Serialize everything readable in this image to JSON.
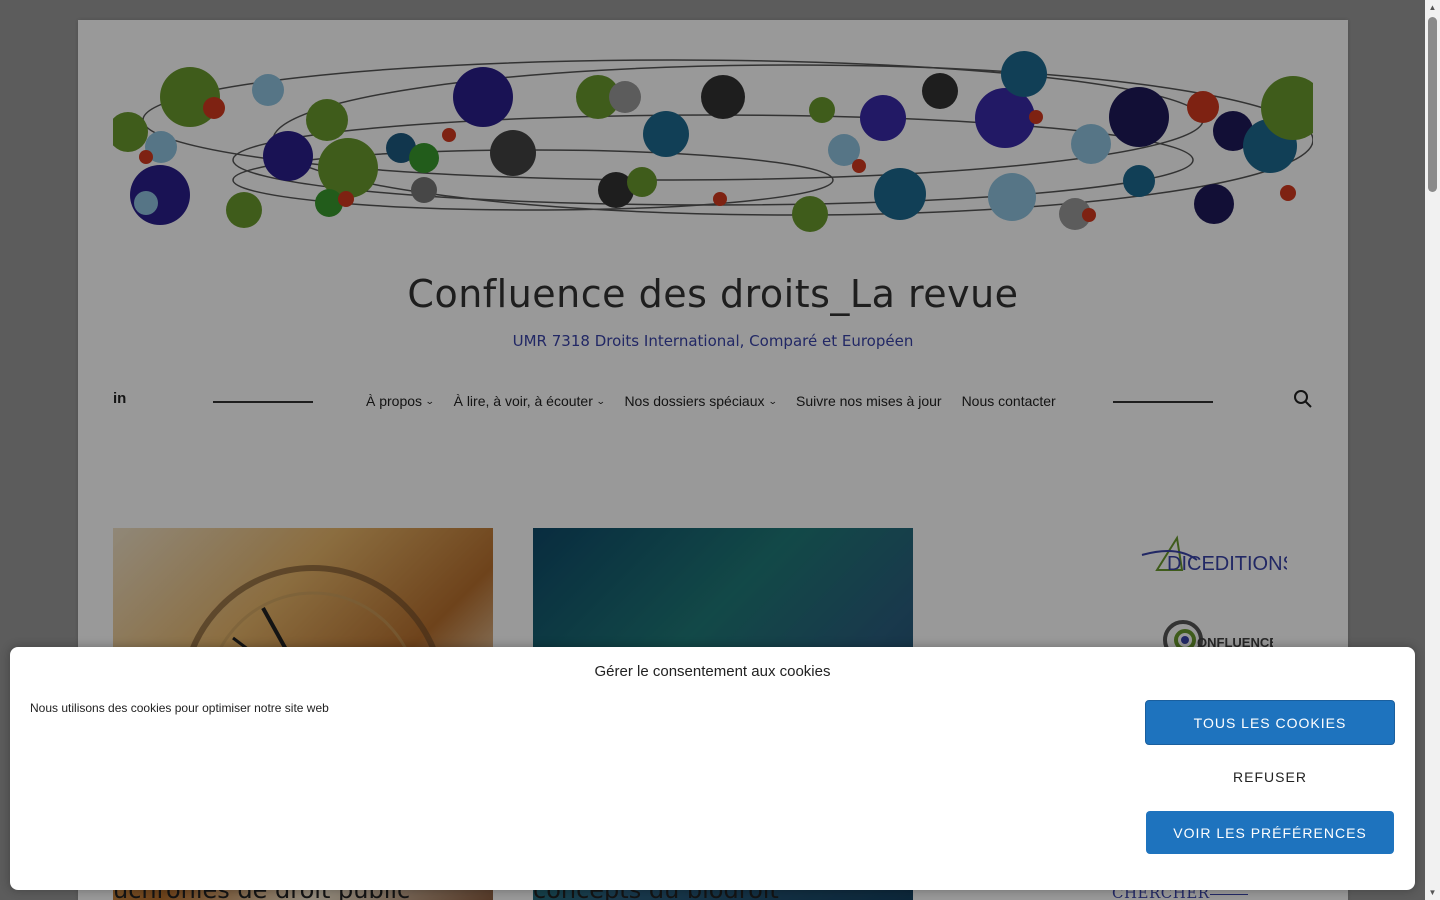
{
  "site": {
    "title": "Confluence des droits_La revue",
    "tagline": "UMR 7318 Droits International, Comparé et Européen"
  },
  "nav": {
    "social_icon": "linkedin-icon",
    "items": [
      {
        "label": "À propos",
        "has_dropdown": true
      },
      {
        "label": "À lire, à voir, à écouter",
        "has_dropdown": true
      },
      {
        "label": "Nos dossiers spéciaux",
        "has_dropdown": true
      },
      {
        "label": "Suivre nos mises à jour",
        "has_dropdown": false
      },
      {
        "label": "Nous contacter",
        "has_dropdown": false
      }
    ],
    "search_icon": "search-icon"
  },
  "posts": [
    {
      "title": "uchronies de droit public"
    },
    {
      "title": "concepts du biodroit"
    }
  ],
  "sidebar": {
    "logo1_text": "DICEDITIONS",
    "logo2_text": "ONFLUENCE",
    "search_heading": "CHERCHER"
  },
  "cookie": {
    "title": "Gérer le consentement aux cookies",
    "message": "Nous utilisons des cookies pour optimiser notre site web",
    "accept_label": "TOUS LES COOKIES",
    "deny_label": "REFUSER",
    "prefs_label": "VOIR LES PRÉFÉRENCES"
  },
  "colors": {
    "accent": "#1e73be",
    "tagline": "#3a44a8"
  }
}
